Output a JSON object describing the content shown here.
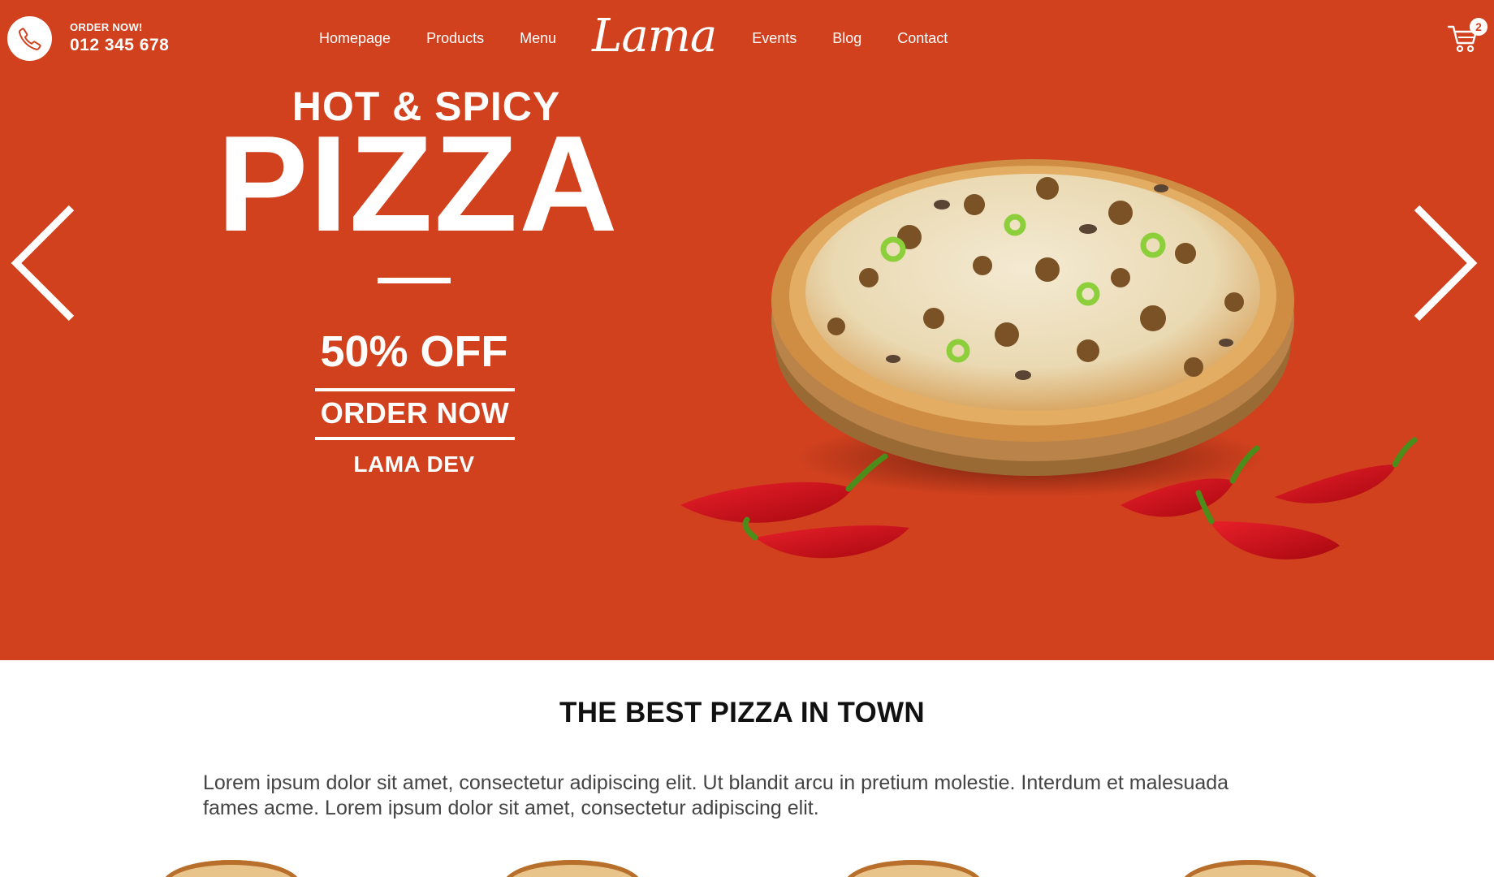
{
  "navbar": {
    "order_label": "ORDER NOW!",
    "phone": "012 345 678",
    "nav_items": [
      "Homepage",
      "Products",
      "Menu"
    ],
    "logo": "Lama",
    "nav_items_right": [
      "Events",
      "Blog",
      "Contact"
    ],
    "cart_count": "2",
    "icons": [
      "phone-icon",
      "cart-icon"
    ]
  },
  "hero": {
    "headline_small": "HOT & SPICY",
    "headline_big": "PIZZA",
    "discount": "50% OFF",
    "cta": "ORDER NOW",
    "brand": "LAMA DEV",
    "icons": [
      "arrow-left-icon",
      "arrow-right-icon"
    ]
  },
  "intro": {
    "title": "THE BEST PIZZA IN TOWN",
    "description": "Lorem ipsum dolor sit amet, consectetur adipiscing elit. Ut blandit arcu in pretium molestie. Interdum et malesuada fames acme. Lorem ipsum dolor sit amet, consectetur adipiscing elit."
  },
  "colors": {
    "brand": "#d1411e",
    "white": "#ffffff",
    "text_dark": "#111111",
    "text_body": "#444444"
  }
}
